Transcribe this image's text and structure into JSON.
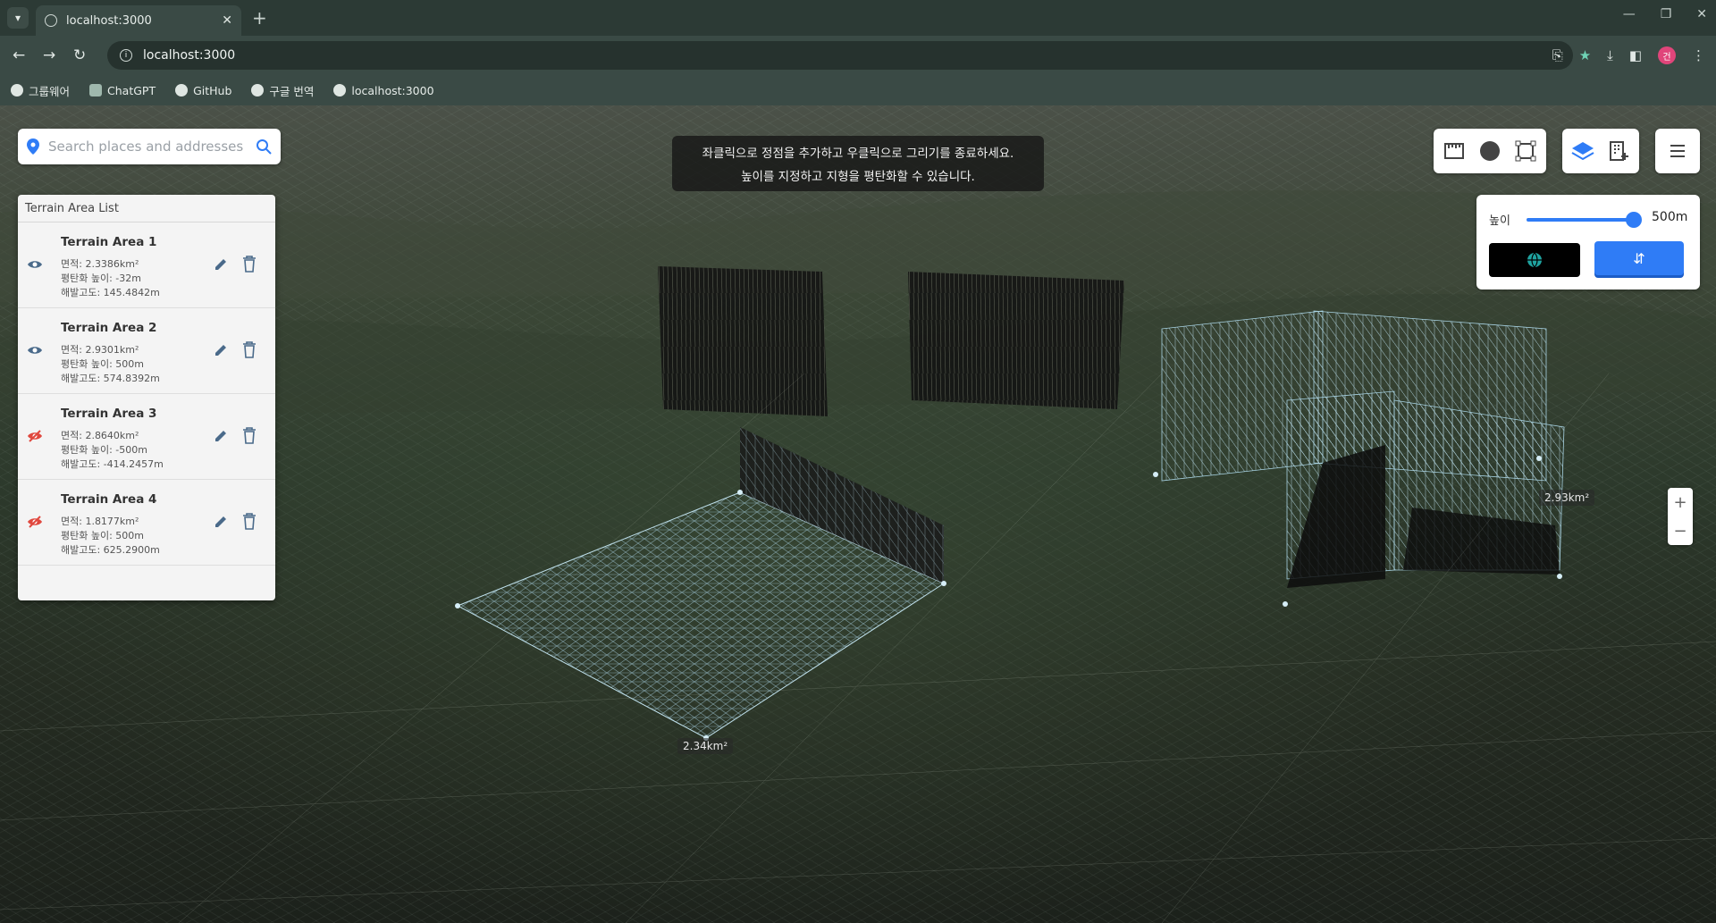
{
  "browser": {
    "tab_title": "localhost:3000",
    "url": "localhost:3000",
    "profile_initial": "건",
    "bookmarks": [
      {
        "label": "그룹웨어"
      },
      {
        "label": "ChatGPT"
      },
      {
        "label": "GitHub"
      },
      {
        "label": "구글 번역"
      },
      {
        "label": "localhost:3000"
      }
    ]
  },
  "search": {
    "placeholder": "Search places and addresses"
  },
  "hint": {
    "line1": "좌클릭으로 정점을 추가하고 우클릭으로 그리기를 종료하세요.",
    "line2": "높이를 지정하고 지형을 평탄화할 수 있습니다."
  },
  "area_list": {
    "title": "Terrain Area List",
    "items": [
      {
        "name": "Terrain Area 1",
        "area": "면적: 2.3386km²",
        "flatten": "평탄화 높이: -32m",
        "elevation": "해발고도: 145.4842m",
        "visible": true
      },
      {
        "name": "Terrain Area 2",
        "area": "면적: 2.9301km²",
        "flatten": "평탄화 높이: 500m",
        "elevation": "해발고도: 574.8392m",
        "visible": true
      },
      {
        "name": "Terrain Area 3",
        "area": "면적: 2.8640km²",
        "flatten": "평탄화 높이: -500m",
        "elevation": "해발고도: -414.2457m",
        "visible": false
      },
      {
        "name": "Terrain Area 4",
        "area": "면적: 1.8177km²",
        "flatten": "평탄화 높이: 500m",
        "elevation": "해발고도: 625.2900m",
        "visible": false
      }
    ]
  },
  "height_panel": {
    "label": "높이",
    "value": "500m",
    "slider_fraction": 1.0
  },
  "map_labels": {
    "area_a": "2.34km²",
    "area_b": "2.93km²"
  },
  "colors": {
    "accent": "#2f7cf6",
    "hidden_eye": "#e0483e",
    "visible_eye": "#4a6a8a"
  },
  "icons": [
    "ruler-icon",
    "circle-icon",
    "polygon-icon",
    "layers-icon",
    "building-plus-icon",
    "menu-icon",
    "globe-icon",
    "flatten-icon"
  ]
}
